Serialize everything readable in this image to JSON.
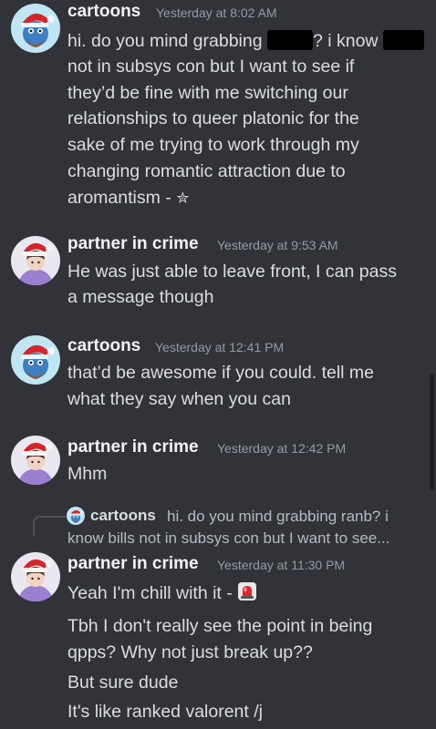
{
  "messages": [
    {
      "author": "cartoons",
      "time": "Yesterday at 8:02 AM",
      "lines": [
        "hi. do you mind grabbing",
        "? i know",
        "not in subsys con but I want to see if",
        "they’d be fine with me switching our",
        "relationships to queer platonic for the",
        "sake of me trying to work through my",
        "changing romantic attraction due to",
        "aromantism -",
        "✮"
      ]
    },
    {
      "author": "partner in crime",
      "time": "Yesterday at 9:53 AM",
      "lines": [
        "He was just able to leave front, I can pass",
        "a message though"
      ]
    },
    {
      "author": "cartoons",
      "time": "Yesterday at 12:41 PM",
      "lines": [
        "that’d be awesome if you could. tell me",
        "what they say when you can"
      ]
    },
    {
      "author": "partner in crime",
      "time": "Yesterday at 12:42 PM",
      "lines": [
        "Mhm"
      ]
    },
    {
      "reply": {
        "author": "cartoons",
        "line1": "hi. do you mind grabbing ranb? i",
        "line2": "know bills not in subsys con but I want to see..."
      },
      "author": "partner in crime",
      "time": "Yesterday at 11:30 PM",
      "lines": [
        "Yeah I'm chill with it -",
        "Tbh I don't really see the point in being",
        "qpps? Why not just break up??",
        "But sure dude",
        "It's like ranked valorent /j"
      ]
    }
  ],
  "icons": {
    "siren": "rotating-light-icon",
    "star": "star-icon"
  },
  "colors": {
    "background": "#313338",
    "text": "#dbdee1",
    "muted": "#949ba4",
    "name": "#f2f3f5"
  }
}
